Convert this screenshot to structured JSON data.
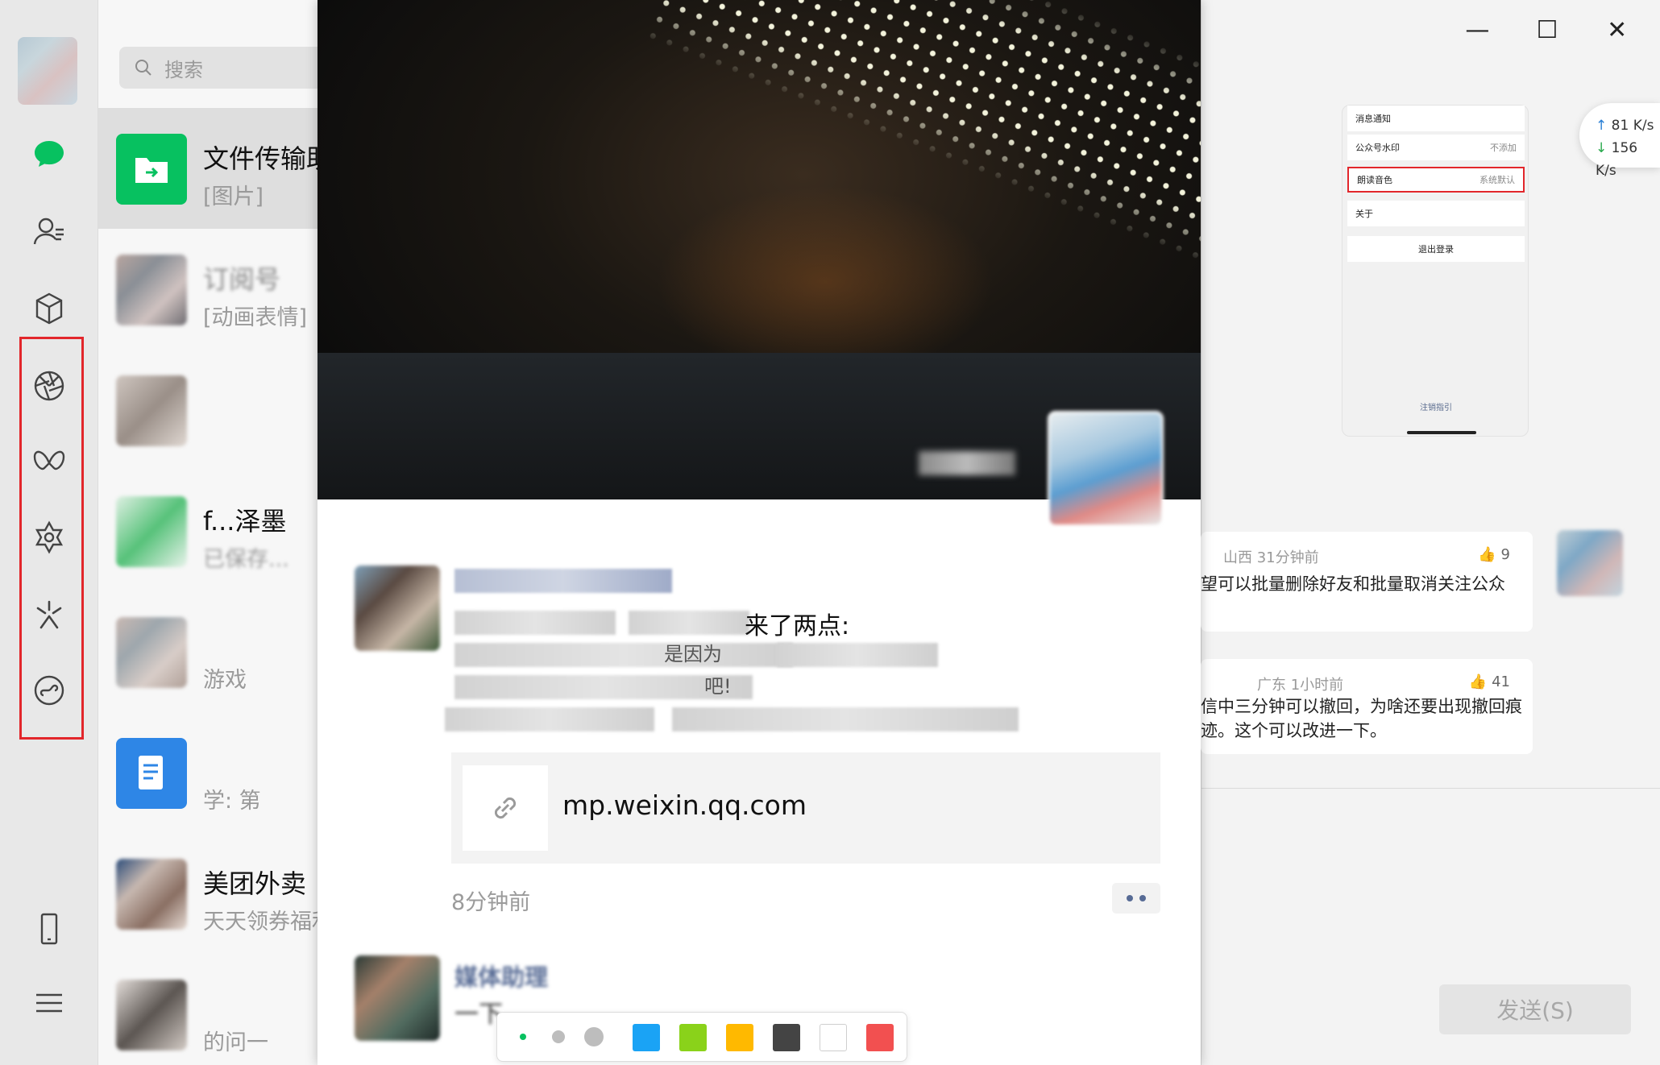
{
  "sidebar": {
    "icons": [
      "chat-icon",
      "contacts-icon",
      "favorites-icon",
      "moments-icon",
      "channels-icon",
      "search-discover-icon",
      "top-stories-icon",
      "mini-programs-icon",
      "phone-icon",
      "menu-icon"
    ]
  },
  "search": {
    "placeholder": "搜索"
  },
  "conversations": [
    {
      "title": "文件传输助手",
      "subtitle": "[图片]"
    },
    {
      "title": "订阅号",
      "subtitle": "[动画表情]"
    },
    {
      "title": "",
      "subtitle": ""
    },
    {
      "title": "f...泽墨",
      "subtitle": "已保存..."
    },
    {
      "title": "",
      "subtitle": "游戏"
    },
    {
      "title": "",
      "subtitle": "学: 第"
    },
    {
      "title": "美团外卖",
      "subtitle": "天天领券福利"
    },
    {
      "title": "",
      "subtitle": "的问一"
    }
  ],
  "moments": {
    "posts": [
      {
        "lines": [
          "来了两点:",
          "是因为",
          "吧!"
        ],
        "link_url": "mp.weixin.qq.com",
        "time": "8分钟前"
      },
      {
        "author": "媒体助理",
        "lines": [
          "一下"
        ]
      }
    ]
  },
  "draw_toolbar": {
    "colors": [
      "#1aa3f5",
      "#8ad21a",
      "#ffb900",
      "#444444",
      "#ffffff",
      "#f25050"
    ]
  },
  "chat": {
    "window_buttons": [
      "—",
      "☐",
      "✕"
    ],
    "net_speed": {
      "up": "81  K/s",
      "down": "156 K/s"
    },
    "phone_settings": [
      {
        "label": "消息通知",
        "value": ""
      },
      {
        "label": "公众号水印",
        "value": "不添加"
      },
      {
        "label": "朗读音色",
        "value": "系统默认"
      },
      {
        "label": "关于",
        "value": ""
      }
    ],
    "phone_logout": "退出登录",
    "phone_help": "注销指引",
    "comments": [
      {
        "meta": "山西 31分钟前",
        "likes": "9",
        "text": "望可以批量删除好友和批量取消关注公众"
      },
      {
        "meta": "广东 1小时前",
        "likes": "41",
        "text": "信中三分钟可以撤回，为啥还要出现撤回痕迹。这个可以改进一下。"
      }
    ],
    "send_label": "发送(S)"
  }
}
